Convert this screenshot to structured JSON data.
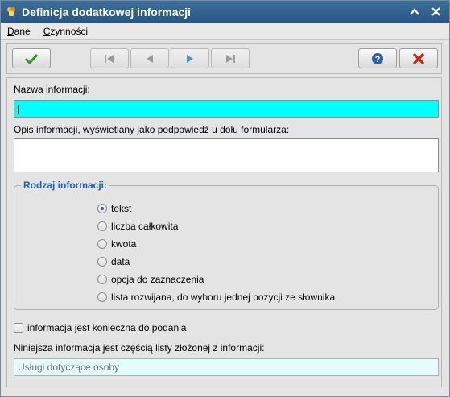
{
  "window": {
    "title": "Definicja dodatkowej informacji"
  },
  "menu": {
    "items": [
      {
        "label_underlined": "D",
        "label_rest": "ane"
      },
      {
        "label_underlined": "C",
        "label_rest": "zynności"
      }
    ]
  },
  "toolbar": {
    "buttons": [
      "confirm",
      "first",
      "previous",
      "next",
      "last",
      "help",
      "cancel"
    ],
    "colors": {
      "confirm": "#2f9a22",
      "cancel": "#d02010",
      "help": "#2e62b0",
      "next_active": "#4d8fdc",
      "disabled": "#9a9a9a"
    }
  },
  "form": {
    "name_label": "Nazwa informacji:",
    "name_value": "",
    "description_label": "Opis informacji, wyświetlany jako podpowiedź u dołu formularza:",
    "description_value": "",
    "type_group_label": "Rodzaj informacji:",
    "type_options": [
      {
        "label": "tekst",
        "checked": true
      },
      {
        "label": "liczba całkowita",
        "checked": false
      },
      {
        "label": "kwota",
        "checked": false
      },
      {
        "label": "data",
        "checked": false
      },
      {
        "label": "opcja do zaznaczenia",
        "checked": false
      },
      {
        "label": "lista rozwijana, do wyboru jednej pozycji ze słownika",
        "checked": false
      }
    ],
    "required_label": "informacja jest konieczna do podania",
    "required_checked": false,
    "list_label": "Niniejsza informacja jest częścią listy złożonej z informacji:",
    "list_value": "Usługi dotyczące osoby"
  }
}
